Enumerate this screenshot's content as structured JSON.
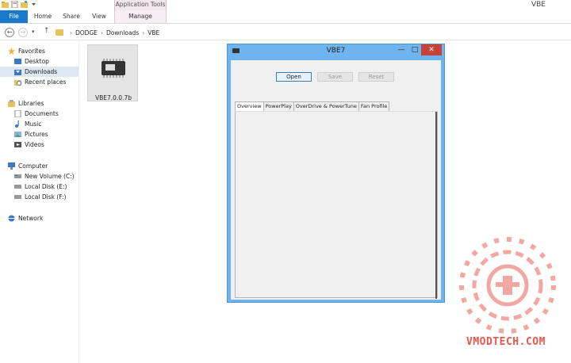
{
  "window": {
    "title": "VBE"
  },
  "ribbon": {
    "context_group": "Application Tools",
    "tabs": [
      "File",
      "Home",
      "Share",
      "View",
      "Manage"
    ]
  },
  "address": {
    "breadcrumb": [
      "DODGE",
      "Downloads",
      "VBE"
    ]
  },
  "nav": {
    "favorites_label": "Favorites",
    "favorites": [
      "Desktop",
      "Downloads",
      "Recent places"
    ],
    "libraries_label": "Libraries",
    "libraries": [
      "Documents",
      "Music",
      "Pictures",
      "Videos"
    ],
    "computer_label": "Computer",
    "drives": [
      "New Volume (C:)",
      "Local Disk (E:)",
      "Local Disk (F:)"
    ],
    "network_label": "Network"
  },
  "files": [
    {
      "name": "VBE7.0.0.7b"
    }
  ],
  "dialog": {
    "title": "VBE7",
    "buttons": {
      "open": "Open",
      "save": "Save",
      "reset": "Reset"
    },
    "tabs": [
      "Overview",
      "PowerPlay",
      "OverDrive & PowerTune",
      "Fan Profile"
    ],
    "active_tab": "Overview"
  },
  "watermark": {
    "text": "VMODTECH.COM"
  },
  "colors": {
    "accent": "#1979ca",
    "dialog_frame": "#6fb4ee",
    "close": "#c7433a",
    "watermark": "#e8574c"
  }
}
